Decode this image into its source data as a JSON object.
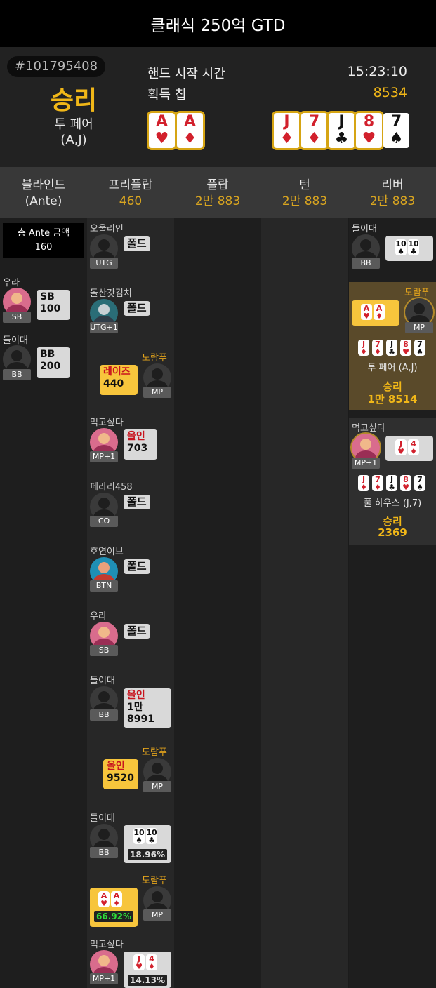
{
  "title": "클래식 250억 GTD",
  "hand": {
    "id": "#101795408",
    "result": "승리",
    "hand_name": "투 페어",
    "hand_cards": "(A,J)",
    "start_label": "핸드 시작 시간",
    "start_time": "15:23:10",
    "chips_label": "획득 칩",
    "chips": "8534",
    "hole": [
      {
        "rank": "A",
        "suit": "♥",
        "color": "red"
      },
      {
        "rank": "A",
        "suit": "♦",
        "color": "red"
      }
    ],
    "board": [
      {
        "rank": "J",
        "suit": "♦",
        "color": "red"
      },
      {
        "rank": "7",
        "suit": "♦",
        "color": "red"
      },
      {
        "rank": "J",
        "suit": "♣",
        "color": "black"
      },
      {
        "rank": "8",
        "suit": "♥",
        "color": "red"
      },
      {
        "rank": "7",
        "suit": "♠",
        "color": "black"
      }
    ]
  },
  "columns": [
    {
      "label": "블라인드",
      "sub": "(Ante)"
    },
    {
      "label": "프리플랍",
      "sub": "460"
    },
    {
      "label": "플랍",
      "sub": "2만 883"
    },
    {
      "label": "턴",
      "sub": "2만 883"
    },
    {
      "label": "리버",
      "sub": "2만 883"
    }
  ],
  "blinds": {
    "ante_label": "총 Ante 금액",
    "ante_value": "160",
    "sb": {
      "name": "우라",
      "pos": "SB",
      "label": "SB",
      "amount": "100"
    },
    "bb": {
      "name": "들이대",
      "pos": "BB",
      "label": "BB",
      "amount": "200"
    }
  },
  "preflop": [
    {
      "name": "오울리인",
      "pos": "UTG",
      "action": "폴드"
    },
    {
      "name": "돌산갓김치",
      "pos": "UTG+1",
      "action": "폴드"
    },
    {
      "name": "도람푸",
      "pos": "MP",
      "action": "레이즈",
      "amount": "440"
    },
    {
      "name": "먹고싶다",
      "pos": "MP+1",
      "action": "올인",
      "amount": "703"
    },
    {
      "name": "페라리458",
      "pos": "CO",
      "action": "폴드"
    },
    {
      "name": "호연이브",
      "pos": "BTN",
      "action": "폴드"
    },
    {
      "name": "우라",
      "pos": "SB",
      "action": "폴드"
    },
    {
      "name": "들이대",
      "pos": "BB",
      "action": "올인",
      "amount1": "1만",
      "amount2": "8991"
    },
    {
      "name": "도람푸",
      "pos": "MP",
      "action": "올인",
      "amount": "9520"
    },
    {
      "name": "들이대",
      "pos": "BB",
      "pct": "18.96%",
      "cards": [
        {
          "rank": "10",
          "suit": "♠",
          "color": "black"
        },
        {
          "rank": "10",
          "suit": "♣",
          "color": "black"
        }
      ]
    },
    {
      "name": "도람푸",
      "pos": "MP",
      "pct": "66.92%",
      "cards": [
        {
          "rank": "A",
          "suit": "♥",
          "color": "red"
        },
        {
          "rank": "A",
          "suit": "♦",
          "color": "red"
        }
      ]
    },
    {
      "name": "먹고싶다",
      "pos": "MP+1",
      "pct": "14.13%",
      "cards": [
        {
          "rank": "J",
          "suit": "♥",
          "color": "red"
        },
        {
          "rank": "4",
          "suit": "♦",
          "color": "red"
        }
      ]
    }
  ],
  "river": {
    "loser": {
      "name": "들이대",
      "pos": "BB",
      "cards": [
        {
          "rank": "10",
          "suit": "♠",
          "color": "black"
        },
        {
          "rank": "10",
          "suit": "♣",
          "color": "black"
        }
      ]
    },
    "winner1": {
      "name": "도람푸",
      "pos": "MP",
      "hand_name": "투 페어 (A,J)",
      "result": "승리",
      "amount": "1만 8514",
      "cards": [
        {
          "rank": "A",
          "suit": "♥",
          "color": "red"
        },
        {
          "rank": "A",
          "suit": "♦",
          "color": "red"
        }
      ]
    },
    "winner2": {
      "name": "먹고싶다",
      "pos": "MP+1",
      "hand_name": "풀 하우스 (J,7)",
      "result": "승리",
      "amount": "2369",
      "cards": [
        {
          "rank": "J",
          "suit": "♥",
          "color": "red"
        },
        {
          "rank": "4",
          "suit": "♦",
          "color": "red"
        }
      ]
    }
  }
}
